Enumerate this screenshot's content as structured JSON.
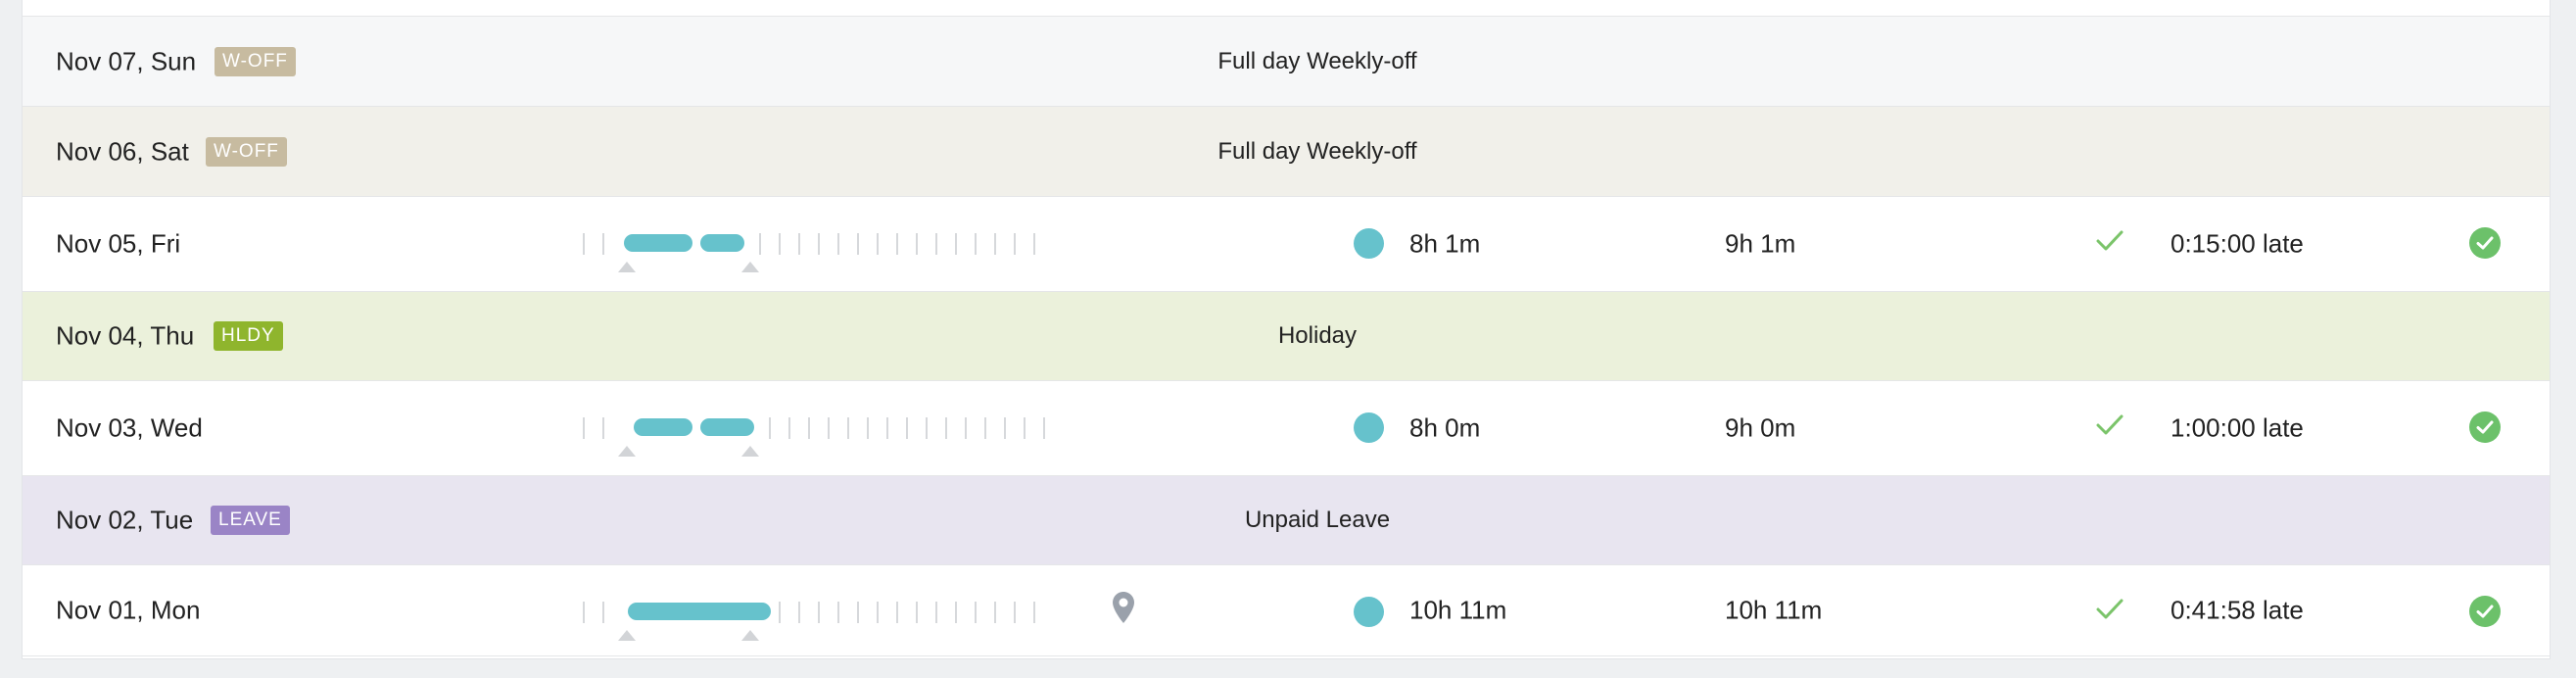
{
  "colors": {
    "woff_badge": "#c7bba0",
    "hldy_badge": "#8fb52d",
    "leave_badge": "#9a84c6",
    "bar": "#66c2cc",
    "check_green": "#7bc46a",
    "status_green": "#6cc16a"
  },
  "rows": [
    {
      "date": "Nov 07, Sun",
      "badge": "W-OFF",
      "label": "Full day Weekly-off"
    },
    {
      "date": "Nov 06, Sat",
      "badge": "W-OFF",
      "label": "Full day Weekly-off"
    },
    {
      "date": "Nov 05, Fri",
      "worked": "8h 1m",
      "total": "9h 1m",
      "late": "0:15:00 late"
    },
    {
      "date": "Nov 04, Thu",
      "badge": "HLDY",
      "label": "Holiday"
    },
    {
      "date": "Nov 03, Wed",
      "worked": "8h 0m",
      "total": "9h 0m",
      "late": "1:00:00 late"
    },
    {
      "date": "Nov 02, Tue",
      "badge": "LEAVE",
      "label": "Unpaid Leave"
    },
    {
      "date": "Nov 01, Mon",
      "worked": "10h 11m",
      "total": "10h 11m",
      "late": "0:41:58 late"
    }
  ],
  "icons": {
    "location": "location-pin-icon",
    "checkmark": "checkmark-icon",
    "approved": "check-circle-icon",
    "presence": "presence-dot"
  }
}
